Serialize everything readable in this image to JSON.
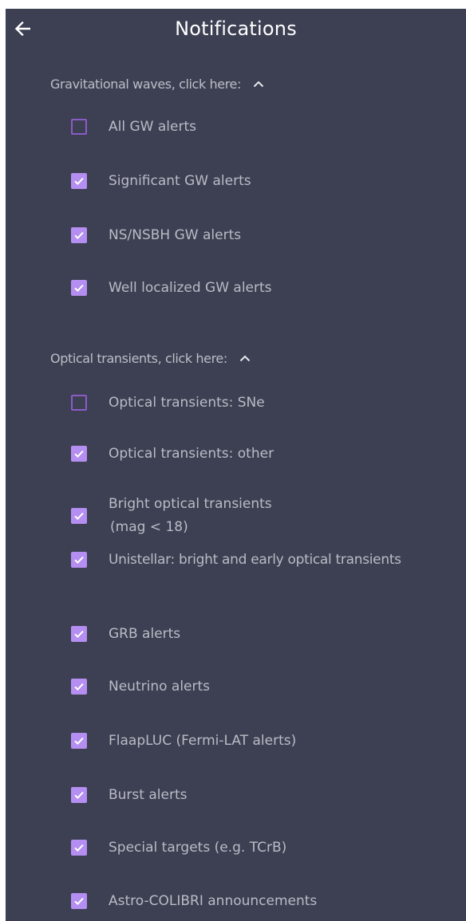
{
  "header": {
    "title": "Notifications",
    "back_icon": "arrow-left-icon"
  },
  "colors": {
    "background": "#3c4052",
    "checkbox_checked": "#b48ef0",
    "checkbox_unchecked_border": "#8a5cc8",
    "text": "#babbc6"
  },
  "sections": {
    "gw": {
      "label": "Gravitational waves, click here:",
      "expanded": true,
      "icon": "chevron-up-icon",
      "items": [
        {
          "label": "All GW alerts",
          "checked": false
        },
        {
          "label": "Significant GW alerts",
          "checked": true
        },
        {
          "label": "NS/NSBH GW alerts",
          "checked": true
        },
        {
          "label": "Well localized GW alerts",
          "checked": true
        }
      ]
    },
    "optical": {
      "label": "Optical transients, click here:",
      "expanded": true,
      "icon": "chevron-up-icon",
      "items": [
        {
          "label": "Optical transients: SNe",
          "checked": false
        },
        {
          "label": "Optical transients: other",
          "checked": true
        },
        {
          "label": "Bright optical transients",
          "label_line2": "(mag < 18)",
          "checked": true
        },
        {
          "label": "Unistellar: bright and early optical transients",
          "checked": true
        }
      ]
    }
  },
  "other_items": [
    {
      "label": "GRB alerts",
      "checked": true
    },
    {
      "label": "Neutrino alerts",
      "checked": true
    },
    {
      "label": "FlaapLUC (Fermi-LAT alerts)",
      "checked": true
    },
    {
      "label": "Burst alerts",
      "checked": true
    },
    {
      "label": "Special targets (e.g. TCrB)",
      "checked": true
    },
    {
      "label": "Astro-COLIBRI announcements",
      "checked": true
    }
  ]
}
